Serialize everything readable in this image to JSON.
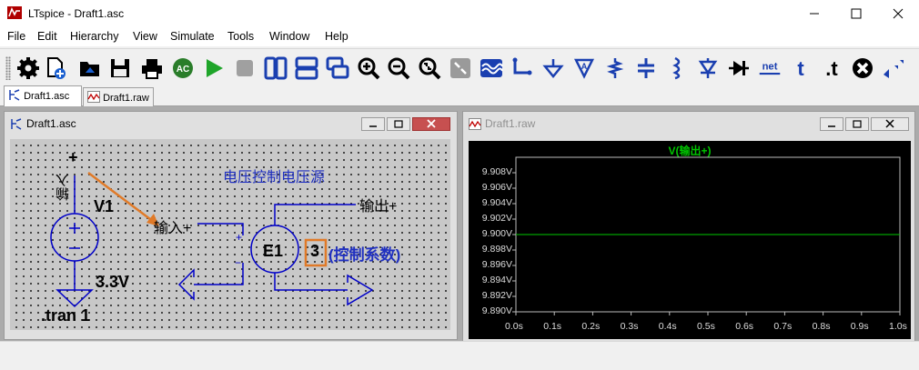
{
  "window": {
    "title": "LTspice - Draft1.asc"
  },
  "menu": [
    "File",
    "Edit",
    "Hierarchy",
    "View",
    "Simulate",
    "Tools",
    "Window",
    "Help"
  ],
  "toolbar": {
    "icons": [
      "settings-gear",
      "new-schematic",
      "open-file",
      "save",
      "print",
      "control-panel-ac",
      "run",
      "halt",
      "tile-vertical",
      "tile-horizontal",
      "cascade",
      "zoom-in",
      "zoom-out",
      "zoom-fit",
      "autorange",
      "waveform",
      "draw-wire",
      "ground",
      "label-net",
      "resistor",
      "capacitor",
      "inductor",
      "diode",
      "component",
      "net",
      "text",
      "spice-directive",
      "delete",
      "move"
    ],
    "net_label": "net",
    "text_label": "t",
    "directive_label": ".t"
  },
  "tabs": [
    {
      "label": "Draft1.asc"
    },
    {
      "label": "Draft1.raw"
    }
  ],
  "schematic": {
    "title": "Draft1.asc",
    "source_name": "V1",
    "source_value": "3.3V",
    "plus_top": "+",
    "input_net_vertical": "输入",
    "input_label": "输入+",
    "output_label": "输出+",
    "annotation": "电压控制电压源",
    "e1_name": "E1",
    "e1_gain": "3",
    "gain_note": "(控制系数)",
    "directive": ".tran 1",
    "colors": {
      "wire": "#0000c8",
      "annotation": "#2030c0",
      "arrow": "#e07a28",
      "highlight": "#e07a28"
    }
  },
  "waveform": {
    "title": "Draft1.raw",
    "trace_label": "V(输出+)",
    "trace_color": "#00c800",
    "chart_data": {
      "type": "line",
      "title": "V(输出+)",
      "x": [
        0.0,
        1.0
      ],
      "y": [
        9.9,
        9.9
      ],
      "xticks": [
        "0.0s",
        "0.1s",
        "0.2s",
        "0.3s",
        "0.4s",
        "0.5s",
        "0.6s",
        "0.7s",
        "0.8s",
        "0.9s",
        "1.0s"
      ],
      "yticks": [
        "9.908V",
        "9.906V",
        "9.904V",
        "9.902V",
        "9.900V",
        "9.898V",
        "9.896V",
        "9.894V",
        "9.892V",
        "9.890V"
      ],
      "xlim": [
        0,
        1
      ],
      "ylim": [
        9.89,
        9.91
      ],
      "grid": true
    }
  }
}
